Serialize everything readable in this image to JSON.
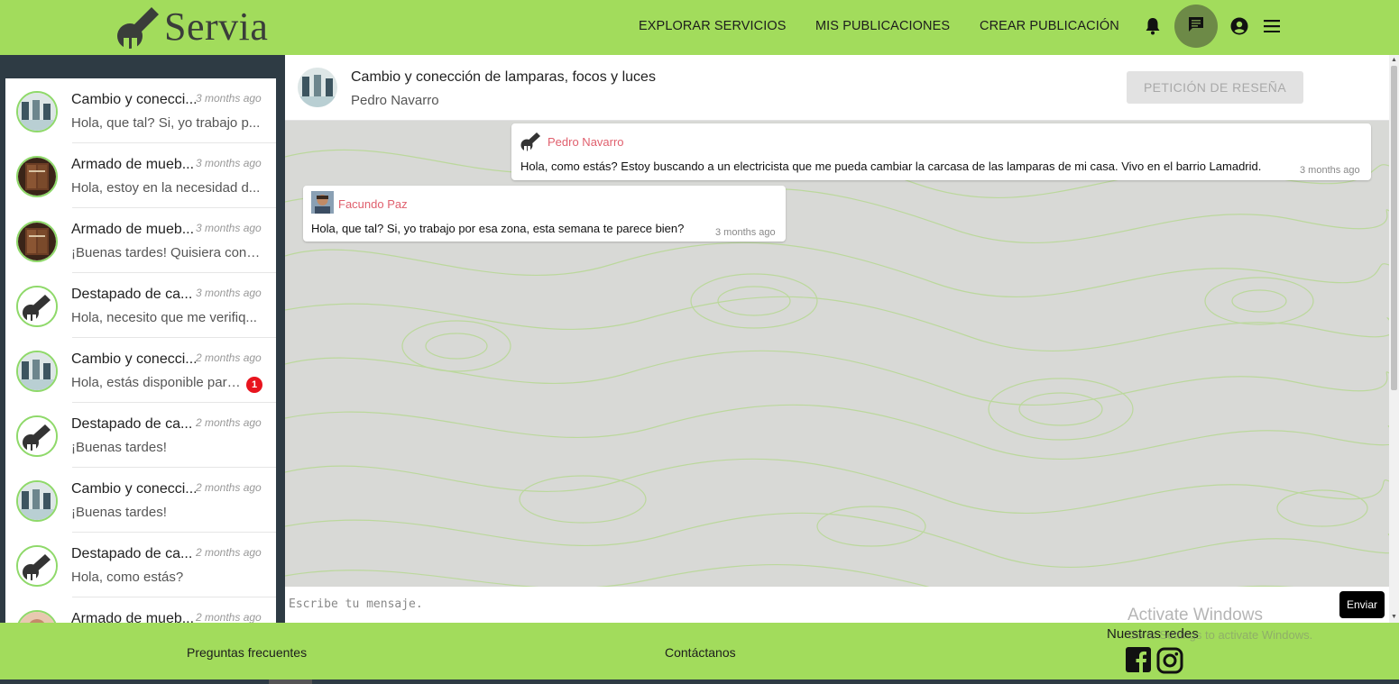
{
  "brand": {
    "name": "Servia",
    "logo_icon": "wrench-icon",
    "header_color": "#a2dc5c"
  },
  "nav": {
    "explore": "EXPLORAR SERVICIOS",
    "my_posts": "MIS PUBLICACIONES",
    "create_post": "CREAR PUBLICACIÓN",
    "icons": [
      "bell-icon",
      "chat-icon",
      "account-icon",
      "menu-icon"
    ]
  },
  "conversations": [
    {
      "title": "Cambio y conecci...",
      "time": "3 months ago",
      "preview": "Hola, que tal? Si, yo trabajo p...",
      "avatar": "lamps"
    },
    {
      "title": "Armado de mueb...",
      "time": "3 months ago",
      "preview": "Hola, estoy en la necesidad d...",
      "avatar": "furniture"
    },
    {
      "title": "Armado de mueb...",
      "time": "3 months ago",
      "preview": "¡Buenas tardes! Quisiera contr...",
      "avatar": "furniture"
    },
    {
      "title": "Destapado de ca...",
      "time": "3 months ago",
      "preview": "Hola, necesito que me verifiq...",
      "avatar": "wrench"
    },
    {
      "title": "Cambio y conecci...",
      "time": "2 months ago",
      "preview": "Hola, estás disponible para...",
      "avatar": "lamps",
      "unread": "1"
    },
    {
      "title": "Destapado de ca...",
      "time": "2 months ago",
      "preview": "¡Buenas tardes!",
      "avatar": "wrench"
    },
    {
      "title": "Cambio y conecci...",
      "time": "2 months ago",
      "preview": "¡Buenas tardes!",
      "avatar": "lamps"
    },
    {
      "title": "Destapado de ca...",
      "time": "2 months ago",
      "preview": "Hola, como estás?",
      "avatar": "wrench"
    },
    {
      "title": "Armado de mueb...",
      "time": "2 months ago",
      "preview": "",
      "avatar": "furniture"
    }
  ],
  "chat": {
    "title": "Cambio y conección de lamparas, focos y luces",
    "subtitle": "Pedro Navarro",
    "review_button": "PETICIÓN DE RESEÑA",
    "messages": [
      {
        "author": "Pedro Navarro",
        "text": "Hola, como estás? Estoy buscando a un electricista que me pueda cambiar la carcasa de las lamparas de mi casa. Vivo en el barrio Lamadrid.",
        "time": "3 months ago",
        "side": "right"
      },
      {
        "author": "Facundo Paz",
        "text": "Hola, que tal? Si, yo trabajo por esa zona, esta semana te parece bien?",
        "time": "3 months ago",
        "side": "left"
      }
    ],
    "composer_placeholder": "Escribe tu mensaje.",
    "send_button": "Enviar"
  },
  "footer": {
    "faq": "Preguntas frecuentes",
    "contact": "Contáctanos",
    "social_title": "Nuestras redes",
    "social_icons": [
      "facebook-icon",
      "instagram-icon"
    ]
  },
  "watermark": {
    "title": "Activate Windows",
    "subtitle": "Go to Settings to activate Windows."
  }
}
